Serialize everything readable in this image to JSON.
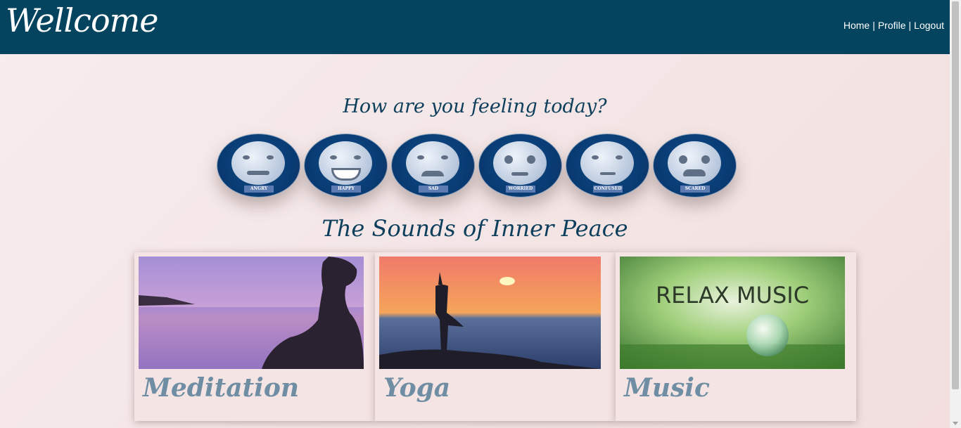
{
  "header": {
    "brand": "Wellcome",
    "nav": [
      {
        "label": "Home"
      },
      {
        "label": "Profile"
      },
      {
        "label": "Logout"
      }
    ],
    "separator": "|",
    "background": "#04445f"
  },
  "moods": {
    "title": "How are you feeling today?",
    "items": [
      {
        "label": "ANGRY",
        "icon": "angry-face-icon"
      },
      {
        "label": "HAPPY",
        "icon": "happy-face-icon"
      },
      {
        "label": "SAD",
        "icon": "sad-face-icon"
      },
      {
        "label": "WORRIED",
        "icon": "worried-face-icon"
      },
      {
        "label": "CONFUSED",
        "icon": "confused-face-icon"
      },
      {
        "label": "SCARED",
        "icon": "scared-face-icon"
      }
    ]
  },
  "sounds": {
    "title": "The Sounds of Inner Peace",
    "cards": [
      {
        "name": "Meditation",
        "image": "meditation-photo"
      },
      {
        "name": "Yoga",
        "image": "yoga-photo"
      },
      {
        "name": "Music",
        "image": "relax-music-photo",
        "image_text": "RELAX MUSIC"
      }
    ]
  }
}
